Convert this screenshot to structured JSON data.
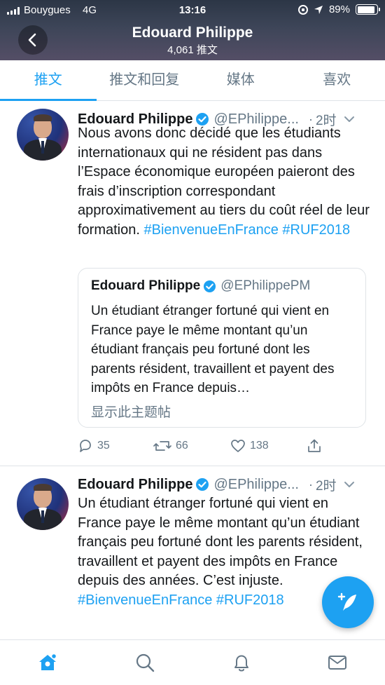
{
  "status_bar": {
    "carrier": "Bouygues",
    "network": "4G",
    "time": "13:16",
    "battery": "89%",
    "battery_level": 0.89
  },
  "header": {
    "name": "Edouard Philippe",
    "tweet_count": "4,061 推文",
    "back_icon": "chevron-left-icon"
  },
  "tabs": [
    {
      "label": "推文",
      "active": true
    },
    {
      "label": "推文和回复",
      "active": false
    },
    {
      "label": "媒体",
      "active": false
    },
    {
      "label": "喜欢",
      "active": false
    }
  ],
  "tweets": [
    {
      "author": "Edouard Philippe",
      "handle": "@EPhilippe...",
      "dot": "·",
      "time": "2时",
      "text_plain": "Nous avons donc décidé que les étudiants internationaux qui ne résident pas dans l’Espace économique européen paieront des frais d’inscription correspondant approximativement au tiers du coût réel de leur formation. ",
      "hashtag1": "#BienvenueEnFrance",
      "hashtag2": "#RUF2018",
      "quote": {
        "author": "Edouard Philippe",
        "handle": "@EPhilippePM",
        "text": "Un étudiant étranger fortuné qui vient en France paye le même montant qu’un étudiant français peu fortuné dont les parents résident, travaillent et payent des impôts en France depuis…",
        "link": "显示此主题帖"
      },
      "actions": {
        "replies": "35",
        "retweets": "66",
        "likes": "138"
      }
    },
    {
      "author": "Edouard Philippe",
      "handle": "@EPhilippe...",
      "dot": "·",
      "time": "2时",
      "text_plain": "Un étudiant étranger fortuné qui vient en France paye le même montant qu’un étudiant français peu fortuné dont les parents résident, travaillent et payent des impôts en France depuis des années. C’est injuste. ",
      "hashtag1": "#BienvenueEnFrance",
      "hashtag2": "#RUF2018"
    }
  ],
  "colors": {
    "accent": "#1da1f2",
    "text": "#14171a",
    "muted": "#657786"
  },
  "bottom_nav": [
    {
      "icon": "home-icon",
      "active": true
    },
    {
      "icon": "search-icon",
      "active": false
    },
    {
      "icon": "bell-icon",
      "active": false
    },
    {
      "icon": "mail-icon",
      "active": false
    }
  ]
}
